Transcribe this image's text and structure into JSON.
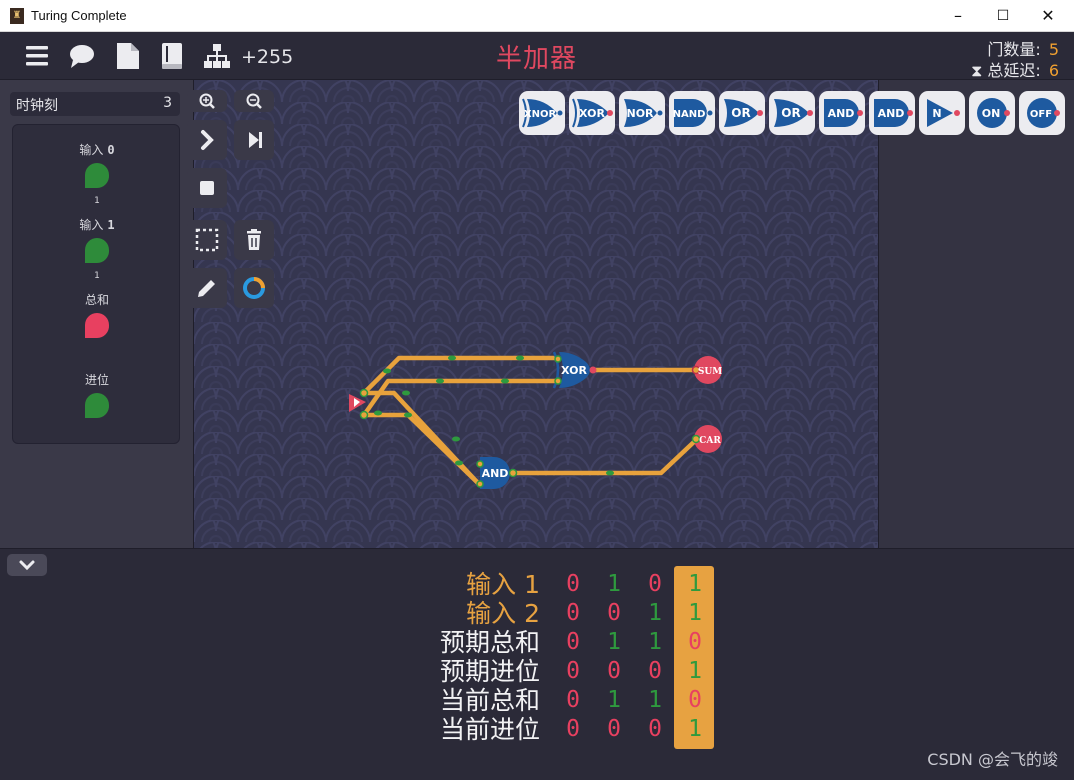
{
  "window": {
    "title": "Turing Complete",
    "minimize": "–",
    "maximize": "☐",
    "close": "✕"
  },
  "toolbar": {
    "icons": [
      "menu-icon",
      "chat-icon",
      "document-icon",
      "book-icon",
      "hierarchy-icon"
    ],
    "score": "+255",
    "level_title": "半加器",
    "gate_count_label": "门数量:",
    "gate_count": "5",
    "delay_label": "⧗ 总延迟:",
    "delay": "6"
  },
  "leftpanel": {
    "clock_label": "时钟刻",
    "clock_value": "3",
    "io": [
      {
        "label": "输入",
        "num": "0",
        "value": "1",
        "color": "#2e8b3a"
      },
      {
        "label": "输入",
        "num": "1",
        "value": "1",
        "color": "#2e8b3a"
      },
      {
        "label": "总和",
        "num": "",
        "value": "",
        "color": "#e84060"
      },
      {
        "label": "进位",
        "num": "",
        "value": "",
        "color": "#2e8b3a"
      }
    ]
  },
  "palette": [
    "XNOR",
    "XOR",
    "NOR",
    "NAND",
    "OR",
    "OR",
    "AND",
    "AND",
    "N",
    "ON",
    "OFF"
  ],
  "circuit": {
    "xor_label": "XOR",
    "and_label": "AND",
    "sum_label": "SUM",
    "car_label": "CAR"
  },
  "truth_table": {
    "rows": [
      {
        "label": "输入 1",
        "color": "#e7a241",
        "values": [
          "0",
          "1",
          "0",
          "1"
        ]
      },
      {
        "label": "输入 2",
        "color": "#e7a241",
        "values": [
          "0",
          "0",
          "1",
          "1"
        ]
      },
      {
        "label": "预期总和",
        "color": "#f2f2f4",
        "values": [
          "0",
          "1",
          "1",
          "0"
        ]
      },
      {
        "label": "预期进位",
        "color": "#f2f2f4",
        "values": [
          "0",
          "0",
          "0",
          "1"
        ]
      },
      {
        "label": "当前总和",
        "color": "#f2f2f4",
        "values": [
          "0",
          "1",
          "1",
          "0"
        ]
      },
      {
        "label": "当前进位",
        "color": "#f2f2f4",
        "values": [
          "0",
          "0",
          "0",
          "1"
        ]
      }
    ],
    "zero_color": "#e84060",
    "one_color": "#2e9a3e"
  },
  "watermark": "CSDN @会飞的竣",
  "colors": {
    "wire": "#e8a23c",
    "gate": "#1e5aa0",
    "output": "#e04860",
    "accent": "#f0a030"
  }
}
